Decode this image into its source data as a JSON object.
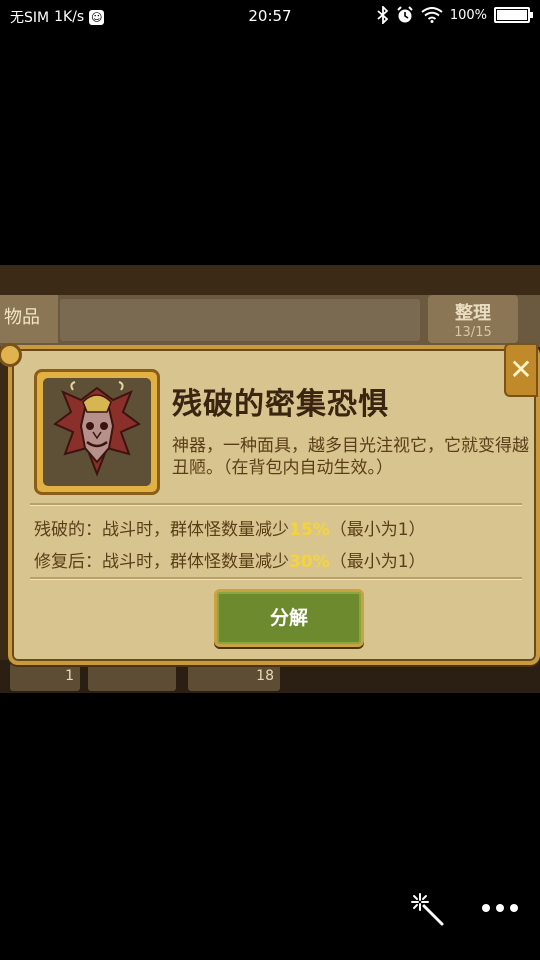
{
  "status_bar": {
    "carrier": "无SIM",
    "speed": "1K/s",
    "time": "20:57",
    "battery_text": "100%",
    "battery_level": 1.0
  },
  "background": {
    "items_tab": "物品",
    "sort_label": "整理",
    "sort_count": "13/15",
    "slot_count_1": "1",
    "slot_count_2": "18"
  },
  "dialog": {
    "title": "残破的密集恐惧",
    "description": "神器，一种面具，越多目光注视它，它就变得越丑陋。（在背包内自动生效。）",
    "effects": [
      {
        "prefix": "残破的：战斗时，群体怪数量减少",
        "percent": "15%",
        "suffix": "（最小为1）"
      },
      {
        "prefix": "修复后：战斗时，群体怪数量减少",
        "percent": "30%",
        "suffix": "（最小为1）"
      }
    ],
    "decompose_label": "分解",
    "close_glyph": "✕"
  },
  "colors": {
    "dialog_bg": "#d8c48e",
    "frame_gold": "#c89a3c",
    "button_green": "#6e8a2e",
    "percent_yellow": "#f4d43c"
  },
  "icons": [
    "bluetooth-icon",
    "alarm-icon",
    "wifi-icon",
    "battery-icon",
    "mask-artifact-icon",
    "close-icon",
    "magic-wand-icon",
    "more-icon"
  ]
}
